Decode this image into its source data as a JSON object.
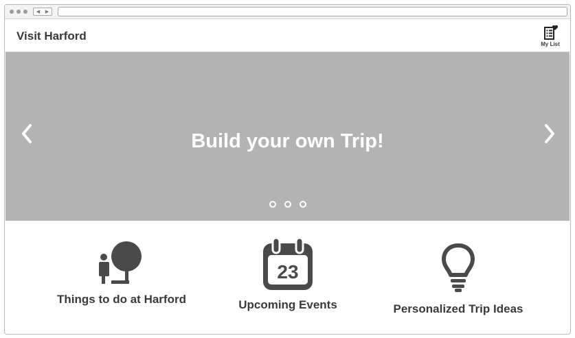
{
  "header": {
    "site_title": "Visit Harford",
    "my_list_label": "My List"
  },
  "hero": {
    "title": "Build your own Trip!",
    "slide_count": 3,
    "active_slide": 1
  },
  "features": [
    {
      "label": "Things to do at Harford",
      "icon": "park-activity-icon"
    },
    {
      "label": "Upcoming Events",
      "icon": "calendar-icon",
      "calendar_day": "23"
    },
    {
      "label": "Personalized Trip Ideas",
      "icon": "lightbulb-icon"
    }
  ],
  "colors": {
    "hero_bg": "#b3b3b3",
    "icon": "#4a4a4a",
    "text": "#3a3a3a"
  }
}
